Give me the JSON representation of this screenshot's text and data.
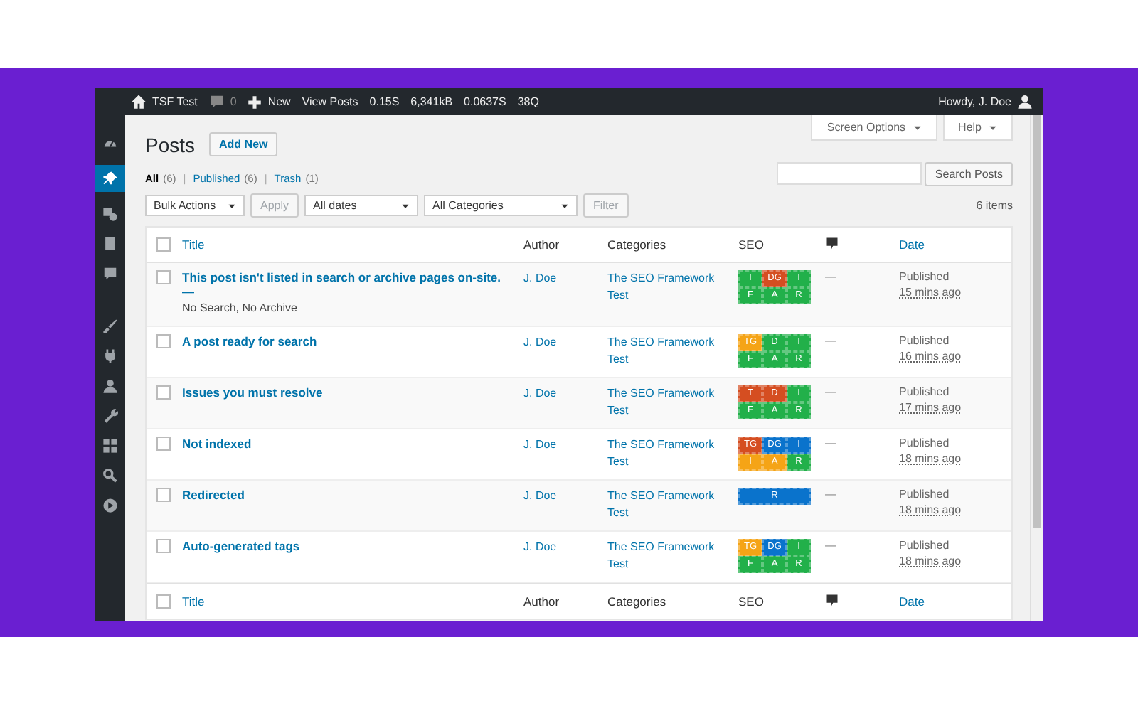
{
  "admin_bar": {
    "site": "TSF Test",
    "comments": "0",
    "new": "New",
    "items": [
      "View Posts",
      "0.15S",
      "6,341kB",
      "0.0637S",
      "38Q"
    ],
    "greeting": "Howdy, J. Doe"
  },
  "sidebar": {
    "items": [
      {
        "selected": false
      },
      {
        "selected": true
      },
      {
        "selected": false
      },
      {
        "selected": false
      },
      {
        "selected": false
      },
      {
        "selected": false
      },
      {
        "selected": false
      },
      {
        "selected": false
      },
      {
        "selected": false
      },
      {
        "selected": false
      },
      {
        "selected": false
      },
      {
        "selected": false
      }
    ]
  },
  "header": {
    "title": "Posts",
    "add_new": "Add New",
    "screen_options": "Screen Options",
    "help": "Help"
  },
  "views": [
    {
      "label": "All",
      "count": "(6)",
      "selected": true
    },
    {
      "separator": "|",
      "label": "Published",
      "count": "(6)",
      "selected": false
    },
    {
      "separator": "|",
      "label": "Trash",
      "count": "(1)",
      "selected": false
    }
  ],
  "search": {
    "button": "Search Posts"
  },
  "filters": {
    "bulk": "Bulk Actions",
    "apply": "Apply",
    "dates": "All dates",
    "categories": "All Categories",
    "filter": "Filter",
    "count": "6 items"
  },
  "table": {
    "select_all_checked": false,
    "columns": [
      "Title",
      "Author",
      "Categories",
      "SEO",
      "Date"
    ],
    "rows": [
      {
        "title": "This post isn't listed in search or archive pages on-site. —",
        "state": "No Search, No Archive",
        "author": "J. Doe",
        "category": "The SEO Framework Test",
        "checked": false,
        "seo": [
          {
            "label": "T",
            "color": "#22b04a"
          },
          {
            "label": "DG",
            "color": "#d54e21"
          },
          {
            "label": "I",
            "color": "#22b04a"
          },
          {
            "label": "F",
            "color": "#22b04a"
          },
          {
            "label": "A",
            "color": "#22b04a"
          },
          {
            "label": "R",
            "color": "#22b04a"
          }
        ],
        "comments": "—",
        "status": "Published",
        "date": "15 mins ago"
      },
      {
        "title": "A post ready for search",
        "author": "J. Doe",
        "category": "The SEO Framework Test",
        "checked": false,
        "seo": [
          {
            "label": "TG",
            "color": "#f5a416"
          },
          {
            "label": "D",
            "color": "#22b04a"
          },
          {
            "label": "I",
            "color": "#22b04a"
          },
          {
            "label": "F",
            "color": "#22b04a"
          },
          {
            "label": "A",
            "color": "#22b04a"
          },
          {
            "label": "R",
            "color": "#22b04a"
          }
        ],
        "comments": "—",
        "status": "Published",
        "date": "16 mins ago"
      },
      {
        "title": "Issues you must resolve",
        "author": "J. Doe",
        "category": "The SEO Framework Test",
        "checked": false,
        "seo": [
          {
            "label": "T",
            "color": "#d54e21"
          },
          {
            "label": "D",
            "color": "#d54e21"
          },
          {
            "label": "I",
            "color": "#22b04a"
          },
          {
            "label": "F",
            "color": "#22b04a"
          },
          {
            "label": "A",
            "color": "#22b04a"
          },
          {
            "label": "R",
            "color": "#22b04a"
          }
        ],
        "comments": "—",
        "status": "Published",
        "date": "17 mins ago"
      },
      {
        "title": "Not indexed",
        "author": "J. Doe",
        "category": "The SEO Framework Test",
        "checked": false,
        "seo": [
          {
            "label": "TG",
            "color": "#d54e21"
          },
          {
            "label": "DG",
            "color": "#0a73cc"
          },
          {
            "label": "I",
            "color": "#0a73cc"
          },
          {
            "label": "I",
            "color": "#f5a416"
          },
          {
            "label": "A",
            "color": "#f5a416"
          },
          {
            "label": "R",
            "color": "#22b04a"
          }
        ],
        "comments": "—",
        "status": "Published",
        "date": "18 mins ago"
      },
      {
        "title": "Redirected",
        "author": "J. Doe",
        "category": "The SEO Framework Test",
        "checked": false,
        "seo": [
          {
            "label": "R",
            "color": "#0a73cc"
          }
        ],
        "comments": "—",
        "status": "Published",
        "date": "18 mins ago"
      },
      {
        "title": "Auto-generated tags",
        "author": "J. Doe",
        "category": "The SEO Framework Test",
        "checked": false,
        "seo": [
          {
            "label": "TG",
            "color": "#f5a416"
          },
          {
            "label": "DG",
            "color": "#0a73cc"
          },
          {
            "label": "I",
            "color": "#22b04a"
          },
          {
            "label": "F",
            "color": "#22b04a"
          },
          {
            "label": "A",
            "color": "#22b04a"
          },
          {
            "label": "R",
            "color": "#22b04a"
          }
        ],
        "comments": "—",
        "status": "Published",
        "date": "18 mins ago"
      }
    ],
    "footer_columns": [
      "Title",
      "Author",
      "Categories",
      "SEO",
      "Date"
    ]
  }
}
